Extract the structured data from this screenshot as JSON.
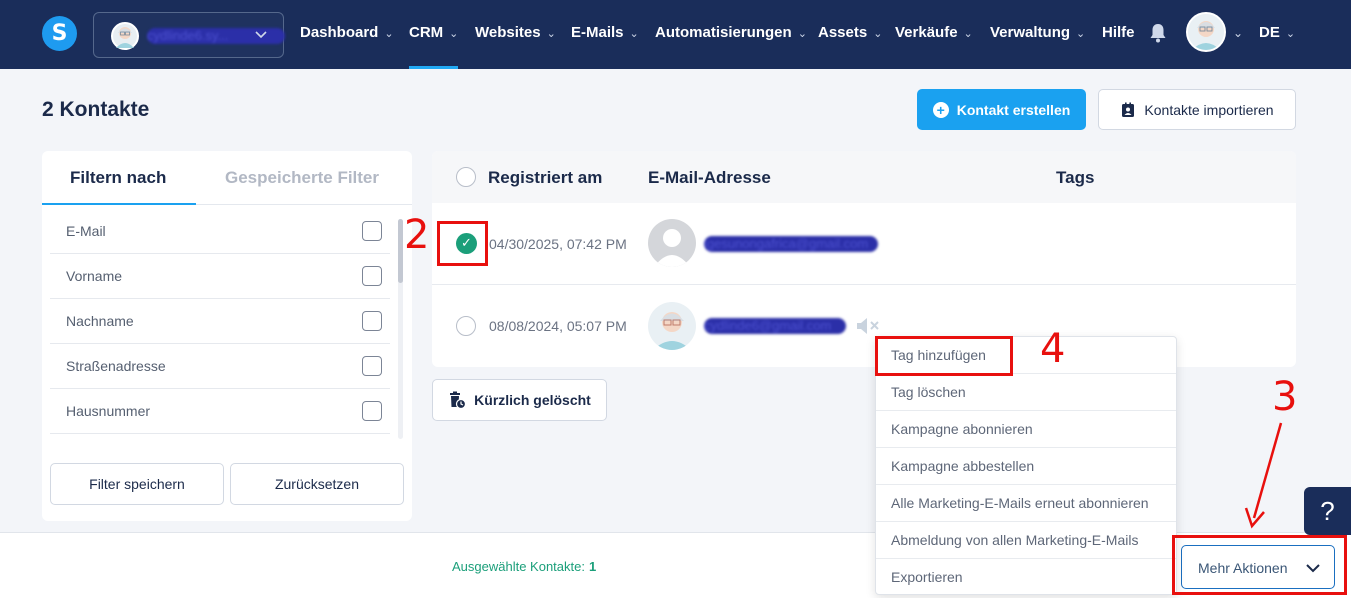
{
  "nav": {
    "logo": "S",
    "account_name": "cydlinde6.sy...",
    "items": [
      {
        "label": "Dashboard",
        "chev": "⌄"
      },
      {
        "label": "CRM",
        "chev": "⌄"
      },
      {
        "label": "Websites",
        "chev": "⌄"
      },
      {
        "label": "E-Mails",
        "chev": "⌄"
      },
      {
        "label": "Automatisierungen",
        "chev": "⌄"
      },
      {
        "label": "Assets",
        "chev": "⌄"
      },
      {
        "label": "Verkäufe",
        "chev": "⌄"
      },
      {
        "label": "Verwaltung",
        "chev": "⌄"
      },
      {
        "label": "Hilfe",
        "chev": ""
      }
    ],
    "active_item": "CRM",
    "language": "DE"
  },
  "header": {
    "title": "2 Kontakte",
    "create_label": "Kontakt erstellen",
    "import_label": "Kontakte importieren"
  },
  "filter": {
    "tab_active": "Filtern nach",
    "tab_inactive": "Gespeicherte Filter",
    "fields": [
      "E-Mail",
      "Vorname",
      "Nachname",
      "Straßenadresse",
      "Hausnummer"
    ],
    "save_label": "Filter speichern",
    "reset_label": "Zurücksetzen"
  },
  "table": {
    "columns": [
      "Registriert am",
      "E-Mail-Adresse",
      "Tags"
    ],
    "rows": [
      {
        "date": "04/30/2025, 07:42 PM",
        "email": "lgesunongafrica@gmail.com",
        "selected": true
      },
      {
        "date": "08/08/2024, 05:07 PM",
        "email": "cydlinde6@gmail.com",
        "selected": false
      }
    ]
  },
  "recently_deleted_label": "Kürzlich gelöscht",
  "footer": {
    "selected_label": "Ausgewählte Kontakte:",
    "selected_count": "1",
    "more_actions_label": "Mehr Aktionen"
  },
  "dropdown": {
    "items": [
      "Tag hinzufügen",
      "Tag löschen",
      "Kampagne abonnieren",
      "Kampagne abbestellen",
      "Alle Marketing-E-Mails erneut abonnieren",
      "Abmeldung von allen Marketing-E-Mails",
      "Exportieren"
    ]
  },
  "help_label": "?",
  "annotations": {
    "n2": "2",
    "n3": "3",
    "n4": "4"
  },
  "colors": {
    "nav_bg": "#1a2d5a",
    "accent": "#1aa1f0",
    "success": "#1b9f7a",
    "annotation": "#e8100e"
  }
}
